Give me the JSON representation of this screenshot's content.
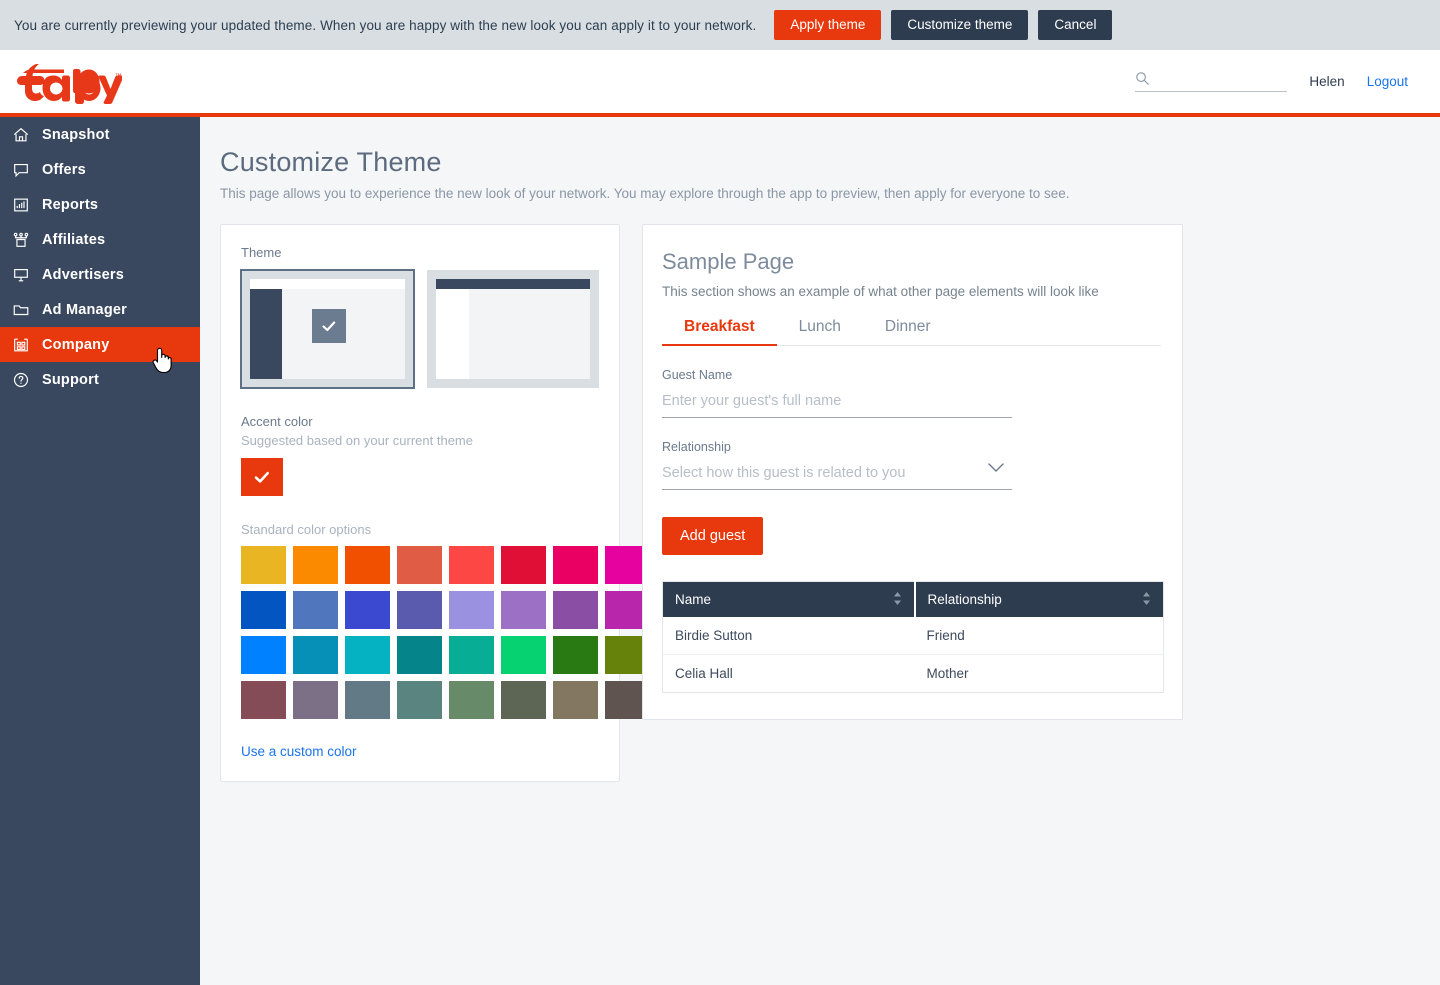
{
  "banner": {
    "message": "You are currently previewing your updated theme. When you are happy with the new look you can apply it to your network.",
    "apply_label": "Apply theme",
    "customize_label": "Customize theme",
    "cancel_label": "Cancel",
    "apply_color": "#e8380d",
    "dark_color": "#2e3c50",
    "background": "#d8dee2"
  },
  "header": {
    "logo_text": "Tapjoy",
    "search_value": "",
    "search_placeholder": "",
    "user_name": "Helen",
    "logout_label": "Logout",
    "accent_rule_color": "#e8380d"
  },
  "sidebar": {
    "background": "#39485e",
    "active_color": "#e8380d",
    "items": [
      {
        "label": "Snapshot",
        "icon": "home-icon",
        "active": false
      },
      {
        "label": "Offers",
        "icon": "speech-bubble-icon",
        "active": false
      },
      {
        "label": "Reports",
        "icon": "bar-chart-icon",
        "active": false
      },
      {
        "label": "Affiliates",
        "icon": "network-icon",
        "active": false
      },
      {
        "label": "Advertisers",
        "icon": "billboard-icon",
        "active": false
      },
      {
        "label": "Ad Manager",
        "icon": "folder-icon",
        "active": false
      },
      {
        "label": "Company",
        "icon": "building-icon",
        "active": true
      },
      {
        "label": "Support",
        "icon": "question-icon",
        "active": false
      }
    ]
  },
  "page": {
    "title": "Customize Theme",
    "subtitle": "This page allows you to experience the new look of your network. You may explore through the app to preview, then apply for everyone to see."
  },
  "theme_panel": {
    "theme_label": "Theme",
    "options": [
      {
        "name": "left-rail-theme",
        "selected": true
      },
      {
        "name": "top-bar-theme",
        "selected": false
      }
    ],
    "accent_label": "Accent color",
    "accent_sublabel": "Suggested based on your current theme",
    "accent_color": "#e8380d",
    "standard_label": "Standard color options",
    "standard_colors": [
      [
        "#eab523",
        "#fc8a00",
        "#f05000",
        "#e15c44",
        "#fd4745",
        "#df0f35",
        "#ea0063",
        "#e5029f"
      ],
      [
        "#0355c2",
        "#5076bd",
        "#3b49d0",
        "#5a5aaf",
        "#9a92e0",
        "#9c70c4",
        "#8a4fa4",
        "#b726ab"
      ],
      [
        "#0081ff",
        "#0690b8",
        "#05b2c2",
        "#058489",
        "#07ad95",
        "#07d272",
        "#2a7a14",
        "#66820a"
      ],
      [
        "#834c57",
        "#7b7086",
        "#617a85",
        "#5a8480",
        "#678a69",
        "#5d6655",
        "#837761",
        "#5f544f"
      ]
    ],
    "custom_link": "Use a custom color"
  },
  "sample_panel": {
    "title": "Sample Page",
    "subtitle": "This section shows an example of what other page elements will look like",
    "tabs": [
      {
        "label": "Breakfast",
        "active": true
      },
      {
        "label": "Lunch",
        "active": false
      },
      {
        "label": "Dinner",
        "active": false
      }
    ],
    "guest_name": {
      "label": "Guest Name",
      "value": "",
      "placeholder": "Enter your guest's full name"
    },
    "relationship": {
      "label": "Relationship",
      "value": "",
      "placeholder": "Select how this guest is related to you"
    },
    "add_button": "Add guest",
    "table": {
      "columns": [
        "Name",
        "Relationship"
      ],
      "rows": [
        [
          "Birdie Sutton",
          "Friend"
        ],
        [
          "Celia Hall",
          "Mother"
        ]
      ]
    }
  }
}
